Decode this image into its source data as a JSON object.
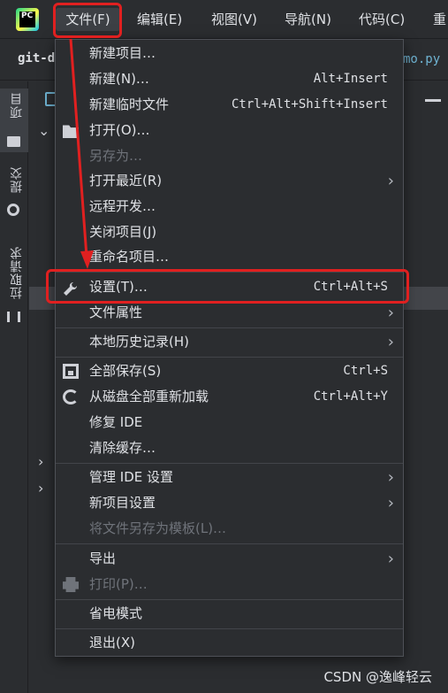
{
  "app": {
    "logo_text": "PC",
    "icon_name": "pycharm-logo-icon"
  },
  "menubar": {
    "items": [
      {
        "label": "文件(F)"
      },
      {
        "label": "编辑(E)"
      },
      {
        "label": "视图(V)"
      },
      {
        "label": "导航(N)"
      },
      {
        "label": "代码(C)"
      },
      {
        "label": "重"
      }
    ]
  },
  "tabrow": {
    "project": "git-demo",
    "editor_tab": "mo.py"
  },
  "left_stripe": {
    "project": "项目",
    "commit": "提交",
    "pull_requests": "拉取请求"
  },
  "file_menu": {
    "items": [
      {
        "label": "新建项目…",
        "shortcut": ""
      },
      {
        "label": "新建(N)…",
        "shortcut": "Alt+Insert"
      },
      {
        "label": "新建临时文件",
        "shortcut": "Ctrl+Alt+Shift+Insert"
      },
      {
        "label": "打开(O)…",
        "shortcut": ""
      },
      {
        "label": "另存为…",
        "shortcut": ""
      },
      {
        "label": "打开最近(R)",
        "shortcut": ""
      },
      {
        "label": "远程开发…",
        "shortcut": ""
      },
      {
        "label": "关闭项目(J)",
        "shortcut": ""
      },
      {
        "label": "重命名项目…",
        "shortcut": ""
      },
      {
        "label": "设置(T)…",
        "shortcut": "Ctrl+Alt+S"
      },
      {
        "label": "文件属性",
        "shortcut": ""
      },
      {
        "label": "本地历史记录(H)",
        "shortcut": ""
      },
      {
        "label": "全部保存(S)",
        "shortcut": "Ctrl+S"
      },
      {
        "label": "从磁盘全部重新加载",
        "shortcut": "Ctrl+Alt+Y"
      },
      {
        "label": "修复 IDE",
        "shortcut": ""
      },
      {
        "label": "清除缓存…",
        "shortcut": ""
      },
      {
        "label": "管理 IDE 设置",
        "shortcut": ""
      },
      {
        "label": "新项目设置",
        "shortcut": ""
      },
      {
        "label": "将文件另存为模板(L)…",
        "shortcut": ""
      },
      {
        "label": "导出",
        "shortcut": ""
      },
      {
        "label": "打印(P)…",
        "shortcut": ""
      },
      {
        "label": "省电模式",
        "shortcut": ""
      },
      {
        "label": "退出(X)",
        "shortcut": ""
      }
    ]
  },
  "annotation": {
    "color": "#e02020"
  },
  "watermark": "CSDN @逸峰轻云"
}
